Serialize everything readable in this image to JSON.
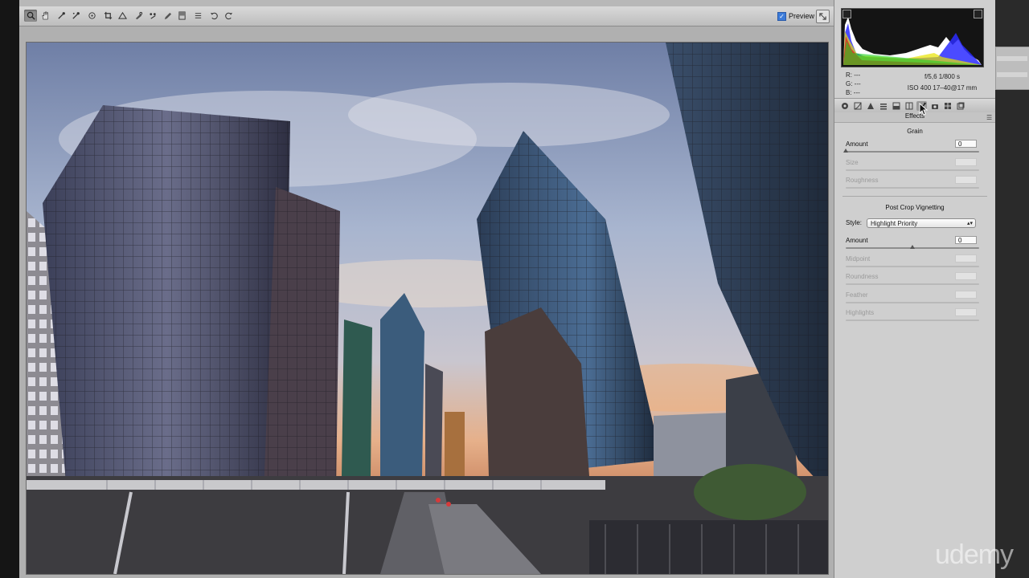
{
  "toolbar": {
    "preview_label": "Preview",
    "preview_checked": true,
    "tools": [
      "zoom-icon",
      "hand-icon",
      "white-balance-icon",
      "color-sampler-icon",
      "target-adjustment-icon",
      "crop-icon",
      "straighten-icon",
      "spot-removal-icon",
      "red-eye-icon",
      "adjustment-brush-icon",
      "graduated-filter-icon",
      "list-icon",
      "rotate-ccw-icon",
      "rotate-cw-icon"
    ]
  },
  "histogram": {
    "r": "R:  ---",
    "g": "G:  ---",
    "b": "B:  ---",
    "aperture_shutter": "f/5,6    1/800 s",
    "iso_lens": "ISO 400    17–40@17 mm"
  },
  "panel": {
    "title": "Effects",
    "tabs": [
      "basic-icon",
      "tone-curve-icon",
      "detail-icon",
      "hsl-icon",
      "split-toning-icon",
      "lens-corrections-icon",
      "effects-icon",
      "camera-calibration-icon",
      "presets-icon",
      "snapshots-icon"
    ],
    "active_tab": 6,
    "grain": {
      "heading": "Grain",
      "amount_label": "Amount",
      "amount_value": "0",
      "amount_level": 0,
      "size_label": "Size",
      "size_value": "",
      "roughness_label": "Roughness",
      "roughness_value": ""
    },
    "vignetting": {
      "heading": "Post Crop Vignetting",
      "style_label": "Style:",
      "style_value": "Highlight Priority",
      "amount_label": "Amount",
      "amount_value": "0",
      "amount_level": 0.5,
      "midpoint_label": "Midpoint",
      "midpoint_value": "",
      "roundness_label": "Roundness",
      "roundness_value": "",
      "feather_label": "Feather",
      "feather_value": "",
      "highlights_label": "Highlights",
      "highlights_value": ""
    }
  },
  "watermark": "udemy",
  "colors": {
    "accent": "#3b7bd9",
    "panel": "#cfcfcf",
    "toolbar": "#c8c8c8"
  }
}
